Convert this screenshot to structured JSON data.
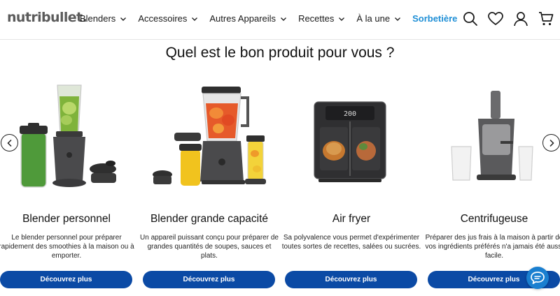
{
  "brand": {
    "logo_text": "nutribullet."
  },
  "nav": {
    "items": [
      {
        "label": "Blenders",
        "has_dropdown": true
      },
      {
        "label": "Accessoires",
        "has_dropdown": true
      },
      {
        "label": "Autres Appareils",
        "has_dropdown": true
      },
      {
        "label": "Recettes",
        "has_dropdown": true
      },
      {
        "label": "À la une",
        "has_dropdown": true
      }
    ],
    "highlight_label": "Sorbetière",
    "icons": [
      "search-icon",
      "heart-icon",
      "account-icon",
      "cart-icon"
    ]
  },
  "main": {
    "title": "Quel est le bon produit pour vous ?",
    "products": [
      {
        "name": "Blender personnel",
        "description": "Le blender personnel pour préparer rapidement des smoothies à la maison ou à emporter.",
        "cta": "Découvrez plus"
      },
      {
        "name": "Blender grande capacité",
        "description": "Un appareil puissant conçu pour préparer de grandes quantités de soupes, sauces et plats.",
        "cta": "Découvrez plus"
      },
      {
        "name": "Air fryer",
        "description": "Sa polyvalence vous permet d'expérimenter toutes sortes de recettes, salées ou sucrées.",
        "cta": "Découvrez plus"
      },
      {
        "name": "Centrifugeuse",
        "description": "Préparer des jus frais à la maison à partir de vos ingrédients préférés n'a jamais été aussi facile.",
        "cta": "Découvrez plus"
      }
    ],
    "display_screen_text": "200"
  },
  "colors": {
    "cta_background": "#0b4aa5",
    "highlight_link": "#1f8fd6",
    "chat_button": "#1a7fd0"
  }
}
